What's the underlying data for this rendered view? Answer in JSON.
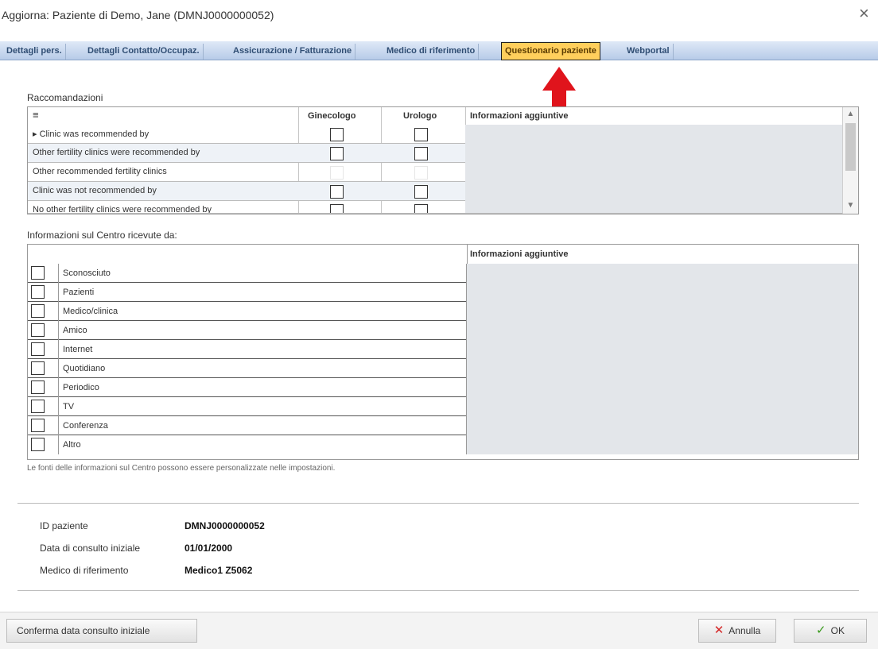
{
  "window": {
    "title": "Aggiorna: Paziente di Demo, Jane (DMNJ0000000052)"
  },
  "tabs": [
    {
      "label": "Dettagli pers."
    },
    {
      "label": "Dettagli Contatto/Occupaz."
    },
    {
      "label": "Assicurazione / Fatturazione"
    },
    {
      "label": "Medico di riferimento"
    },
    {
      "label": "Questionario paziente"
    },
    {
      "label": "Webportal"
    }
  ],
  "active_tab": "Questionario paziente",
  "recommendations": {
    "section_label": "Raccomandazioni",
    "sort_glyph": "≡",
    "columns": {
      "ginecologo": "Ginecologo",
      "urologo": "Urologo",
      "info": "Informazioni aggiuntive"
    },
    "rows": [
      {
        "label": "Clinic was recommended by"
      },
      {
        "label": "Other fertility clinics were recommended by"
      },
      {
        "label": "Other recommended fertility clinics"
      },
      {
        "label": "Clinic was not recommended by"
      },
      {
        "label": "No other fertility clinics were recommended by"
      }
    ]
  },
  "sources": {
    "section_label": "Informazioni sul Centro ricevute da:",
    "info_header": "Informazioni aggiuntive",
    "rows": [
      {
        "label": "Sconosciuto"
      },
      {
        "label": "Pazienti"
      },
      {
        "label": "Medico/clinica"
      },
      {
        "label": "Amico"
      },
      {
        "label": "Internet"
      },
      {
        "label": "Quotidiano"
      },
      {
        "label": "Periodico"
      },
      {
        "label": "TV"
      },
      {
        "label": "Conferenza"
      },
      {
        "label": "Altro"
      }
    ],
    "note": "Le fonti delle informazioni sul Centro possono essere personalizzate nelle impostazioni."
  },
  "patient_info": {
    "id_label": "ID paziente",
    "id_value": "DMNJ0000000052",
    "date_label": "Data di consulto iniziale",
    "date_value": "01/01/2000",
    "doctor_label": "Medico di riferimento",
    "doctor_value": "Medico1 Z5062"
  },
  "buttons": {
    "confirm_consult": "Conferma data consulto iniziale",
    "cancel": "Annulla",
    "ok": "OK"
  },
  "colors": {
    "active_tab": "#ffcf5c",
    "arrow": "#e0141c",
    "cancel_icon": "#d42424",
    "ok_icon": "#3a9a1e"
  }
}
